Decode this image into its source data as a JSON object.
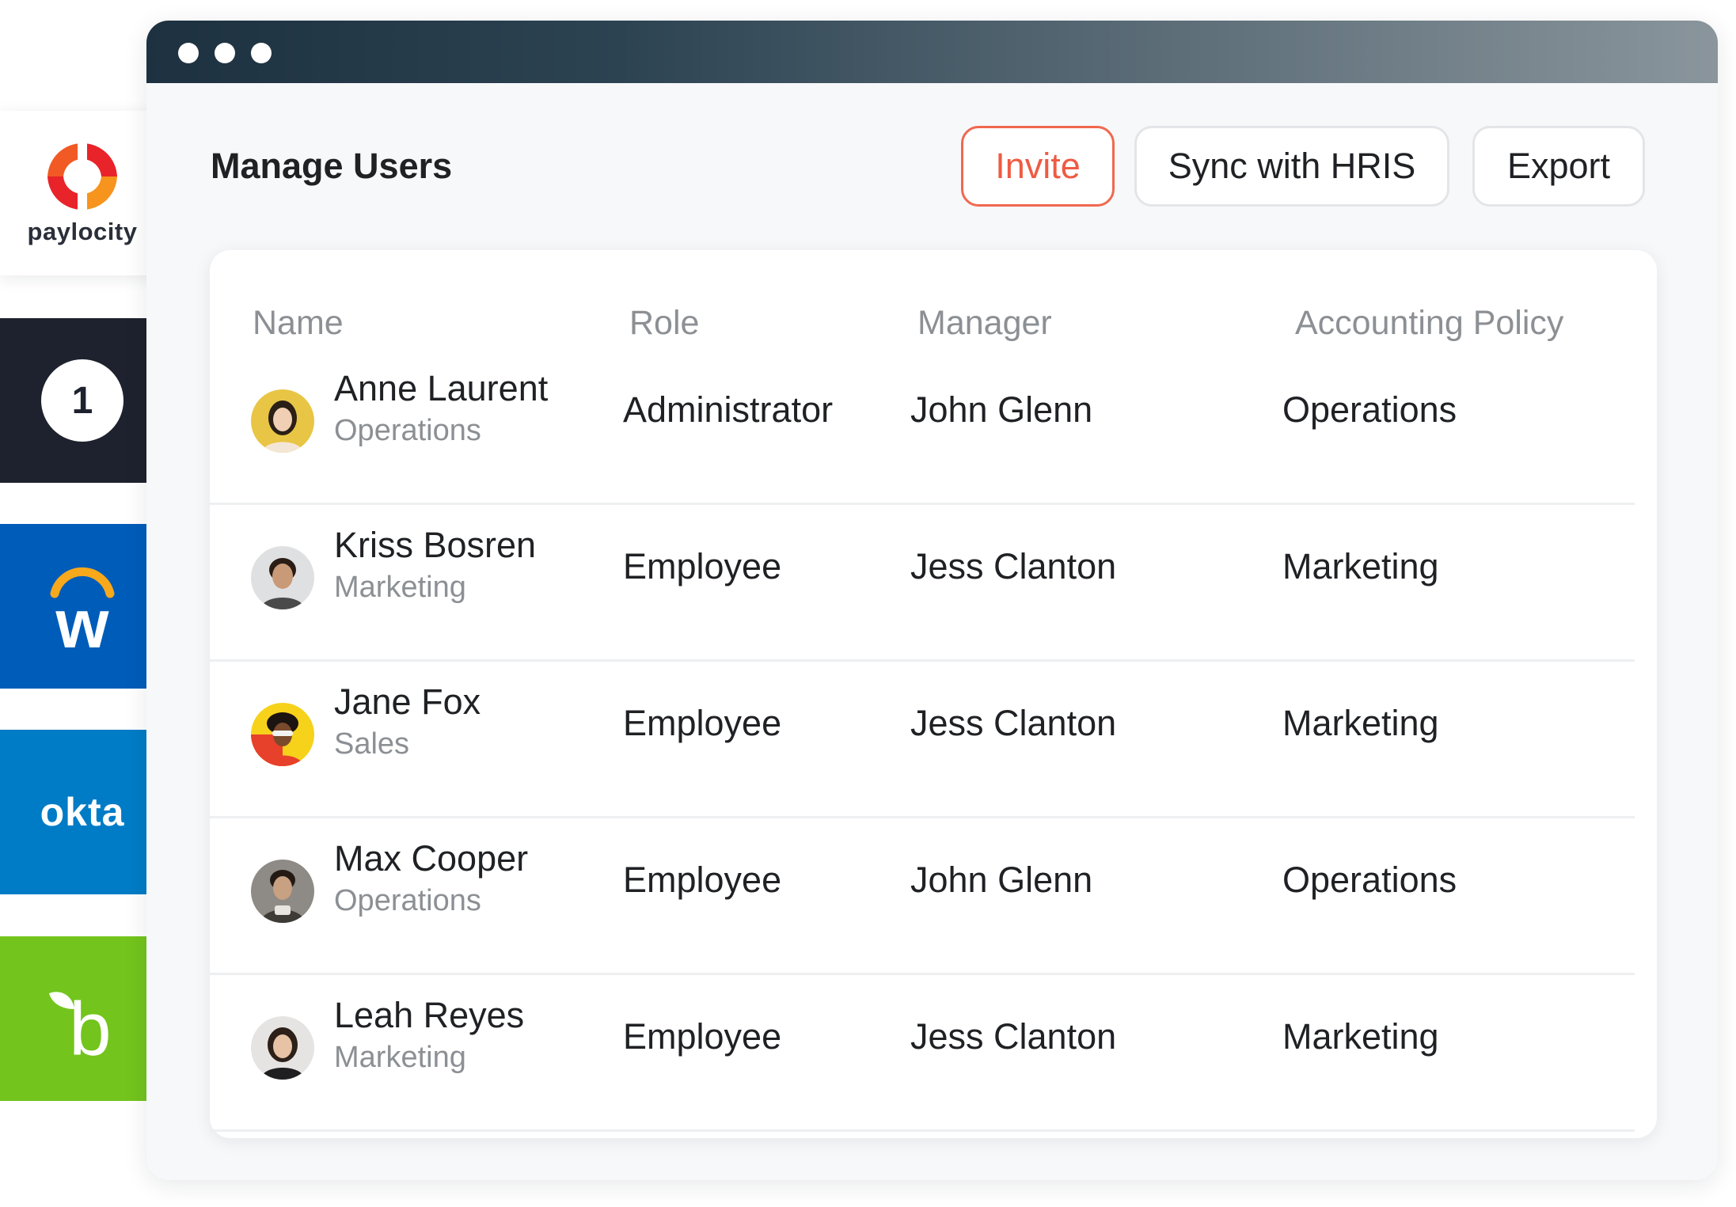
{
  "integrations": [
    {
      "name": "paylocity",
      "label": "paylocity",
      "icon": "paylocity-logo-icon",
      "bg": "#ffffff"
    },
    {
      "name": "1password",
      "label": "1",
      "icon": "1password-logo-icon",
      "bg": "#1e222e"
    },
    {
      "name": "workday",
      "label": "w",
      "icon": "workday-logo-icon",
      "bg": "#005cb9"
    },
    {
      "name": "okta",
      "label": "okta",
      "icon": "okta-logo-icon",
      "bg": "#007cc6"
    },
    {
      "name": "bamboohr",
      "label": "b",
      "icon": "bamboohr-logo-icon",
      "bg": "#73c41d"
    }
  ],
  "window": {
    "controls": [
      "window-dot-icon",
      "window-dot-icon",
      "window-dot-icon"
    ]
  },
  "header": {
    "title": "Manage Users",
    "buttons": {
      "invite": "Invite",
      "sync": "Sync with HRIS",
      "export": "Export"
    },
    "accent_color": "#ee5b43"
  },
  "table": {
    "columns": [
      "Name",
      "Role",
      "Manager",
      "Accounting Policy"
    ],
    "rows": [
      {
        "name": "Anne Laurent",
        "department": "Operations",
        "role": "Administrator",
        "manager": "John Glenn",
        "policy": "Operations"
      },
      {
        "name": "Kriss Bosren",
        "department": "Marketing",
        "role": "Employee",
        "manager": "Jess Clanton",
        "policy": "Marketing"
      },
      {
        "name": "Jane Fox",
        "department": "Sales",
        "role": "Employee",
        "manager": "Jess Clanton",
        "policy": "Marketing"
      },
      {
        "name": "Max Cooper",
        "department": "Operations",
        "role": "Employee",
        "manager": "John Glenn",
        "policy": "Operations"
      },
      {
        "name": "Leah Reyes",
        "department": "Marketing",
        "role": "Employee",
        "manager": "Jess Clanton",
        "policy": "Marketing"
      }
    ]
  }
}
